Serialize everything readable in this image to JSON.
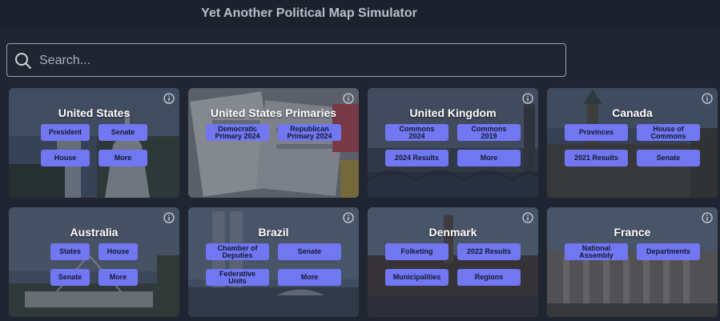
{
  "header": {
    "title": "Yet Another Political Map Simulator"
  },
  "search": {
    "placeholder": "Search..."
  },
  "cards": [
    {
      "title": "United States",
      "buttons": [
        "President",
        "Senate",
        "House",
        "More"
      ]
    },
    {
      "title": "United States Primaries",
      "buttons": [
        "Democratic\nPrimary 2024",
        "Republican\nPrimary 2024"
      ]
    },
    {
      "title": "United Kingdom",
      "buttons": [
        "Commons\n2024",
        "Commons\n2019",
        "2024 Results",
        "More"
      ]
    },
    {
      "title": "Canada",
      "buttons": [
        "Provinces",
        "House of\nCommons",
        "2021 Results",
        "Senate"
      ]
    },
    {
      "title": "Australia",
      "buttons": [
        "States",
        "House",
        "Senate",
        "More"
      ]
    },
    {
      "title": "Brazil",
      "buttons": [
        "Chamber of\nDeputies",
        "Senate",
        "Federative\nUnits",
        "More"
      ]
    },
    {
      "title": "Denmark",
      "buttons": [
        "Folketing",
        "2022 Results",
        "Municipalities",
        "Regions"
      ]
    },
    {
      "title": "France",
      "buttons": [
        "National\nAssembly",
        "Departments"
      ]
    }
  ],
  "colors": {
    "button": "#7177f0",
    "page_bg": "#1f2632"
  }
}
